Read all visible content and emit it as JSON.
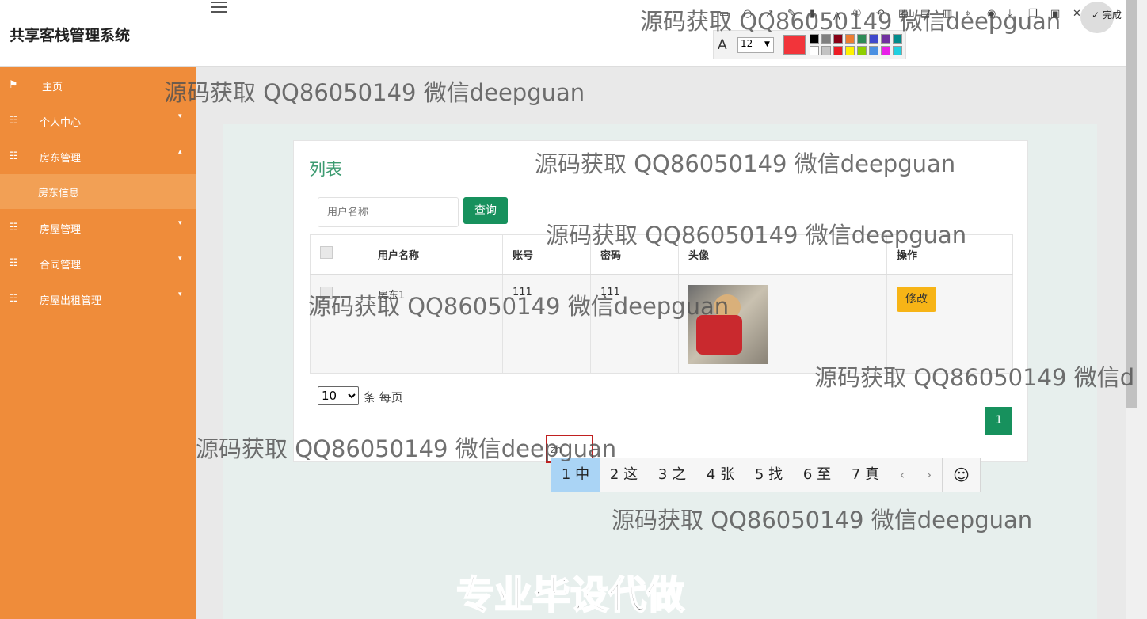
{
  "header": {
    "app_title": "共享客栈管理系统"
  },
  "sidebar": {
    "items": [
      {
        "label": "主页",
        "icon": "flag-icon",
        "caret": ""
      },
      {
        "label": "个人中心",
        "icon": "grid-icon",
        "caret": "▾"
      },
      {
        "label": "房东管理",
        "icon": "grid-icon",
        "caret": "▴"
      },
      {
        "label": "房屋管理",
        "icon": "grid-icon",
        "caret": "▾"
      },
      {
        "label": "合同管理",
        "icon": "grid-icon",
        "caret": "▾"
      },
      {
        "label": "房屋出租管理",
        "icon": "grid-icon",
        "caret": "▾"
      }
    ],
    "sub_item": "房东信息",
    "colors": {
      "background": "#ef8c3a",
      "active_sub": "#f2a055"
    }
  },
  "main": {
    "title": "列表",
    "search": {
      "placeholder": "用户名称",
      "button": "查询"
    },
    "table": {
      "headers": [
        "",
        "用户名称",
        "账号",
        "密码",
        "头像",
        "操作"
      ],
      "rows": [
        {
          "username": "房东1",
          "account": "111",
          "password": "111",
          "action": "修改"
        }
      ]
    },
    "page_size": "10",
    "per_page_label": "条 每页",
    "current_page": "1",
    "accent_color": "#17915d"
  },
  "ime": {
    "input": "zh",
    "candidates": [
      "1 中",
      "2 这",
      "3 之",
      "4 张",
      "5 找",
      "6 至",
      "7 真"
    ],
    "prev": "‹",
    "next": "›",
    "emoji": "☺"
  },
  "annotation_toolbar": {
    "done_label": "完成",
    "font_size": "12",
    "current_color": "#f2343a"
  },
  "watermarks": {
    "text": "源码获取 QQ86050149 微信deepguan",
    "text_cut": "源码获取 QQ86050149 微信d",
    "bottom": "专业毕设代做"
  }
}
